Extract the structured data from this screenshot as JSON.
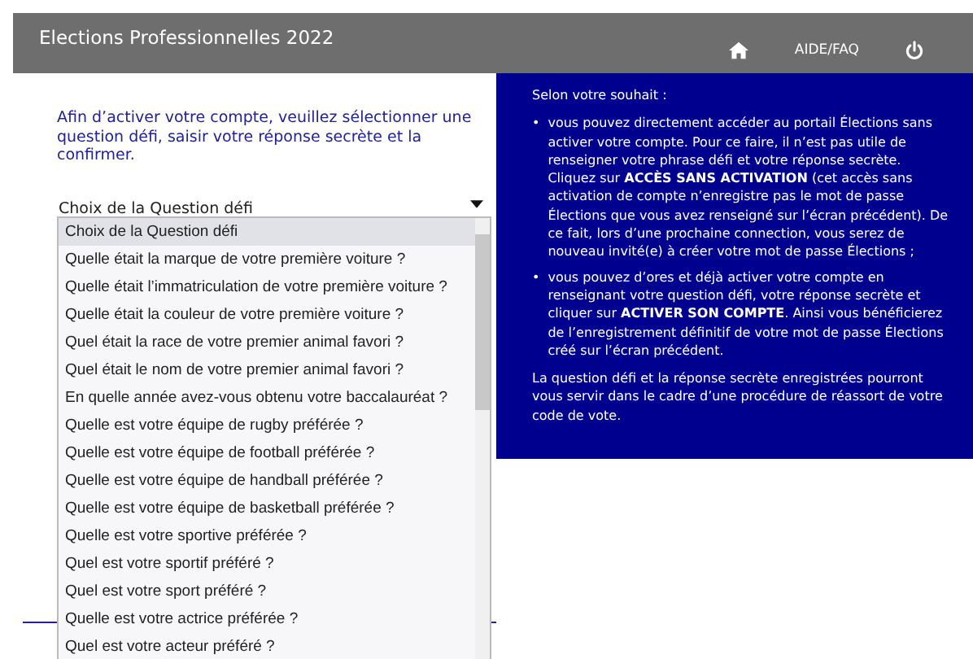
{
  "header": {
    "title": "Elections Professionnelles 2022",
    "nav": [
      {
        "kind": "home"
      },
      {
        "kind": "link",
        "label": "AIDE/FAQ"
      },
      {
        "kind": "power"
      }
    ]
  },
  "form": {
    "intro": "Afin d’activer votre compte, veuillez sélectionner une question défi, saisir votre réponse secrète et la confirmer.",
    "select": {
      "value": "Choix de la Question défi",
      "expanded": true
    },
    "options": [
      {
        "label": "Choix de la Question défi",
        "selected": true
      },
      {
        "label": "Quelle était la marque de votre première voiture ?",
        "selected": false
      },
      {
        "label": "Quelle était l’immatriculation de votre première voiture ?",
        "selected": false
      },
      {
        "label": "Quelle était la couleur de votre première voiture ?",
        "selected": false
      },
      {
        "label": "Quel était la race de votre premier animal favori ?",
        "selected": false
      },
      {
        "label": "Quel était le nom de votre premier animal favori ?",
        "selected": false
      },
      {
        "label": "En quelle année avez-vous obtenu votre baccalauréat ?",
        "selected": false
      },
      {
        "label": "Quelle est votre équipe de rugby préférée ?",
        "selected": false
      },
      {
        "label": "Quelle est votre équipe de football préférée ?",
        "selected": false
      },
      {
        "label": "Quelle est votre équipe de handball préférée ?",
        "selected": false
      },
      {
        "label": "Quelle est votre équipe de basketball préférée ?",
        "selected": false
      },
      {
        "label": "Quelle est votre sportive préférée ?",
        "selected": false
      },
      {
        "label": "Quel est votre sportif préféré ?",
        "selected": false
      },
      {
        "label": "Quel est votre sport préféré ?",
        "selected": false
      },
      {
        "label": "Quelle est votre actrice préférée ?",
        "selected": false
      },
      {
        "label": "Quel est votre acteur préféré ?",
        "selected": false
      }
    ]
  },
  "info": {
    "heading": "Selon votre souhait :",
    "bullets": [
      {
        "marker": "•",
        "text": "vous pouvez directement accéder au portail Élections sans activer votre compte. Pour ce faire, il n’est pas utile de renseigner votre phrase défi et votre réponse secrète. Cliquez sur **ACCÈS SANS ACTIVATION** (cet accès sans activation de compte n’enregistre pas le mot de passe Élections que vous avez renseigné sur l’écran précédent). De ce fait, lors d’une prochaine connection, vous serez de nouveau invité(e) à créer votre mot de passe Élections ;"
      },
      {
        "marker": "•",
        "text": "vous pouvez d’ores et déjà activer votre compte en renseignant votre question défi, votre réponse secrète et cliquer sur **ACTIVER SON COMPTE**. Ainsi vous bénéficierez de l’enregistrement définitif de votre mot de passe Élections créé sur l’écran précédent."
      }
    ],
    "note": "La question défi et la réponse secrète enregistrées pourront vous servir dans le cadre d’une procédure de réassort de votre code de vote."
  }
}
